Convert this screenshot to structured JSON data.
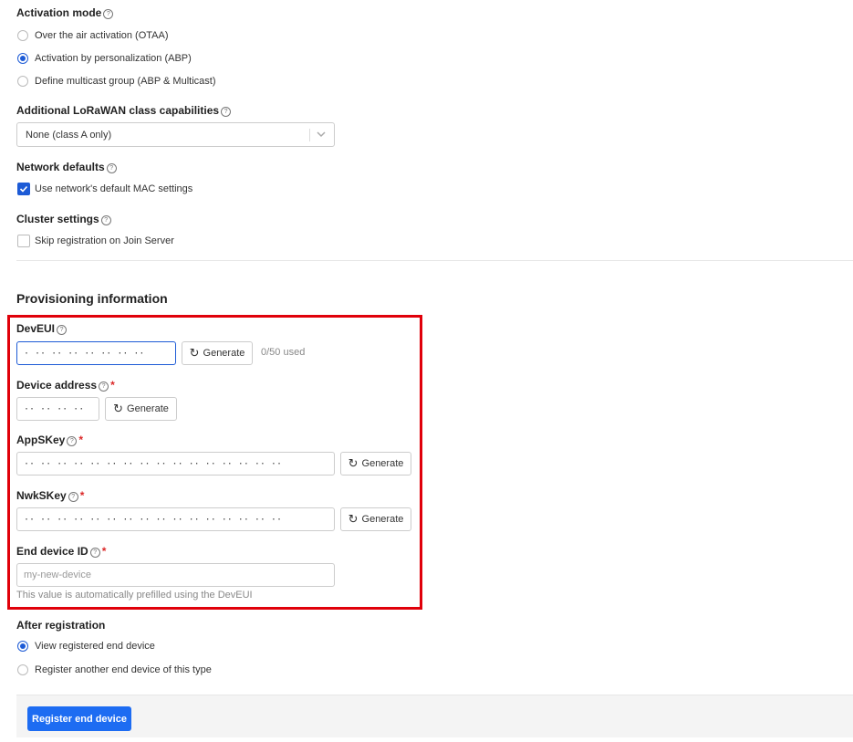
{
  "activation_mode": {
    "label": "Activation mode",
    "options": [
      {
        "label": "Over the air activation (OTAA)",
        "checked": false
      },
      {
        "label": "Activation by personalization (ABP)",
        "checked": true
      },
      {
        "label": "Define multicast group (ABP & Multicast)",
        "checked": false
      }
    ]
  },
  "class_capabilities": {
    "label": "Additional LoRaWAN class capabilities",
    "selected": "None (class A only)"
  },
  "network_defaults": {
    "label": "Network defaults",
    "checkbox_label": "Use network's default MAC settings",
    "checked": true
  },
  "cluster_settings": {
    "label": "Cluster settings",
    "checkbox_label": "Skip registration on Join Server",
    "checked": false
  },
  "provisioning": {
    "title": "Provisioning information",
    "deveui": {
      "label": "DevEUI",
      "value": "· ·· ·· ·· ·· ·· ·· ··",
      "generate_label": "Generate",
      "usage": "0/50 used"
    },
    "device_address": {
      "label": "Device address",
      "required": "*",
      "value": "·· ·· ·· ··",
      "generate_label": "Generate"
    },
    "appskey": {
      "label": "AppSKey",
      "required": "*",
      "value": "·· ·· ·· ·· ·· ·· ·· ·· ·· ·· ·· ·· ·· ·· ·· ··",
      "generate_label": "Generate"
    },
    "nwkskey": {
      "label": "NwkSKey",
      "required": "*",
      "value": "·· ·· ·· ·· ·· ·· ·· ·· ·· ·· ·· ·· ·· ·· ·· ··",
      "generate_label": "Generate"
    },
    "end_device_id": {
      "label": "End device ID",
      "required": "*",
      "placeholder": "my-new-device",
      "hint": "This value is automatically prefilled using the DevEUI"
    }
  },
  "after_registration": {
    "label": "After registration",
    "options": [
      {
        "label": "View registered end device",
        "checked": true
      },
      {
        "label": "Register another end device of this type",
        "checked": false
      }
    ]
  },
  "submit_label": "Register end device",
  "colors": {
    "accent": "#1d5bd6",
    "highlight": "#e0000a",
    "primary_button": "#1d6cf2"
  },
  "icons": {
    "help": "help-circle-icon",
    "refresh": "refresh-icon",
    "chevron": "chevron-down-icon",
    "check": "checkmark-icon"
  }
}
